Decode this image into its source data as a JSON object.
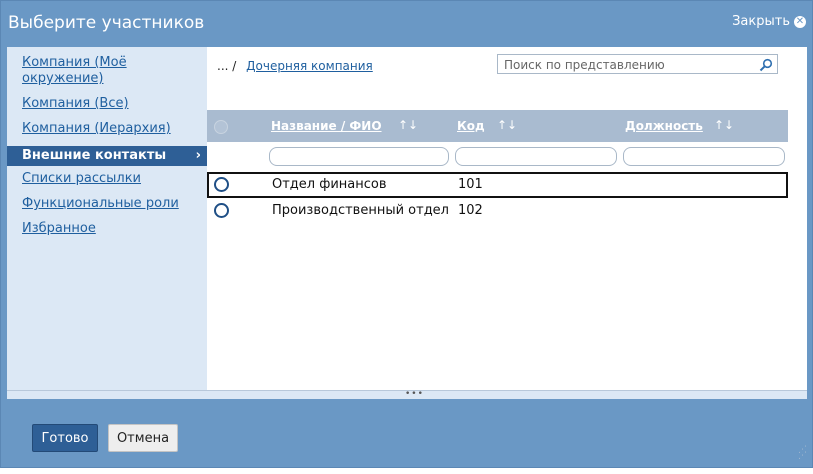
{
  "dialog": {
    "title": "Выберите участников",
    "close_label": "Закрыть"
  },
  "sidebar": {
    "items": [
      {
        "label": "Компания (Моё окружение)",
        "active": false
      },
      {
        "label": "Компания (Все)",
        "active": false
      },
      {
        "label": "Компания (Иерархия)",
        "active": false
      },
      {
        "label": "Внешние контакты",
        "active": true
      },
      {
        "label": "Списки рассылки",
        "active": false
      },
      {
        "label": "Функциональные роли",
        "active": false
      },
      {
        "label": "Избранное",
        "active": false
      }
    ],
    "active_chevron": "›"
  },
  "breadcrumb": {
    "ellipsis": "...",
    "separator": "/",
    "current": "Дочерняя компания"
  },
  "search": {
    "placeholder": "Поиск по представлению",
    "icon": "search-icon"
  },
  "grid": {
    "columns": [
      {
        "label": "Название / ФИО",
        "sort": "↑↓"
      },
      {
        "label": "Код",
        "sort": "↑↓"
      },
      {
        "label": "Должность",
        "sort": "↑↓"
      }
    ],
    "rows": [
      {
        "name": "Отдел финансов",
        "code": "101",
        "position": "",
        "selected": true
      },
      {
        "name": "Производственный отдел",
        "code": "102",
        "position": "",
        "selected": false
      }
    ]
  },
  "footer": {
    "done_label": "Готово",
    "cancel_label": "Отмена"
  },
  "colors": {
    "dialog_bg": "#6a98c5",
    "sidebar_bg": "#dce8f5",
    "active_item": "#2e5f96",
    "grid_header": "#a9bbd0",
    "link": "#1f5f9f"
  }
}
